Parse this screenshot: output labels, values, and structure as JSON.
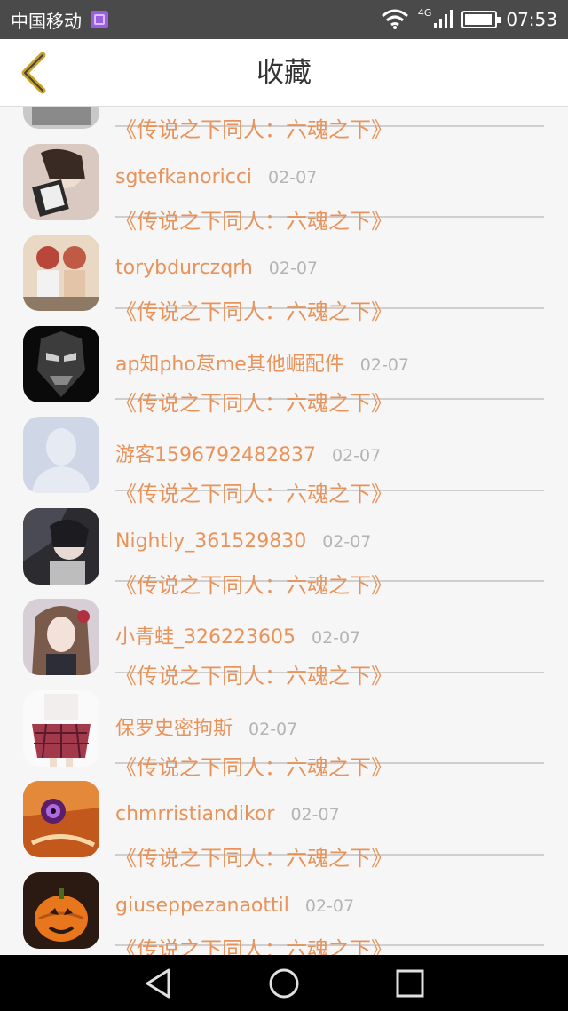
{
  "status_bar": {
    "carrier": "中国移动",
    "network": "4G",
    "time": "07:53"
  },
  "header": {
    "title": "收藏",
    "back_icon": "chevron-left-icon",
    "accent_color": "#c9a226"
  },
  "items": [
    {
      "name": "",
      "date": "",
      "title": "《传说之下同人：六魂之下》",
      "avatar": "avatar-photo-girl-mask"
    },
    {
      "name": "sgtefkanoricci",
      "date": "02-07",
      "title": "《传说之下同人：六魂之下》",
      "avatar": "avatar-photo-girl-cards"
    },
    {
      "name": "torybdurczqrh",
      "date": "02-07",
      "title": "《传说之下同人：六魂之下》",
      "avatar": "avatar-photo-two-kids"
    },
    {
      "name": "ap知pho荩me其他崛配件",
      "date": "02-07",
      "title": "《传说之下同人：六魂之下》",
      "avatar": "avatar-dark-mask"
    },
    {
      "name": "游客1596792482837",
      "date": "02-07",
      "title": "《传说之下同人：六魂之下》",
      "avatar": "avatar-default-silhouette"
    },
    {
      "name": "Nightly_361529830",
      "date": "02-07",
      "title": "《传说之下同人：六魂之下》",
      "avatar": "avatar-anime-dark"
    },
    {
      "name": "小青蛙_326223605",
      "date": "02-07",
      "title": "《传说之下同人：六魂之下》",
      "avatar": "avatar-anime-girl"
    },
    {
      "name": "保罗史密拘斯",
      "date": "02-07",
      "title": "《传说之下同人：六魂之下》",
      "avatar": "avatar-skirt"
    },
    {
      "name": "chmrristiandikor",
      "date": "02-07",
      "title": "《传说之下同人：六魂之下》",
      "avatar": "avatar-anime-eye"
    },
    {
      "name": "giuseppezanaottil",
      "date": "02-07",
      "title": "《传说之下同人：六魂之下》",
      "avatar": "avatar-pumpkin"
    }
  ],
  "colors": {
    "name_text": "#e8935a",
    "date_text": "#b4b4b4",
    "list_bg": "#f6f6f6"
  },
  "android_nav": {
    "back": "triangle-back-icon",
    "home": "circle-home-icon",
    "recents": "square-recents-icon"
  }
}
